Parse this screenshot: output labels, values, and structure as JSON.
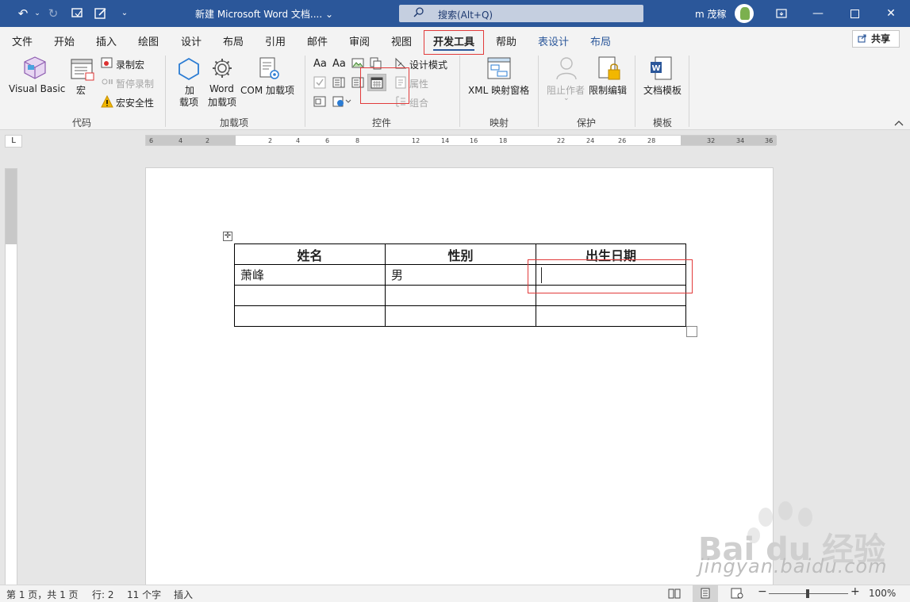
{
  "titlebar": {
    "doc_title": "新建 Microsoft Word 文档.... ⌄",
    "search_placeholder": "搜索(Alt+Q)",
    "user_name": "m 茂稼"
  },
  "menu": {
    "tabs": [
      "文件",
      "开始",
      "插入",
      "绘图",
      "设计",
      "布局",
      "引用",
      "邮件",
      "审阅",
      "视图",
      "开发工具",
      "帮助",
      "表设计",
      "布局"
    ],
    "active_tab": "开发工具",
    "share_label": "共享"
  },
  "ribbon": {
    "code": {
      "visual_basic": "Visual Basic",
      "macro": "宏",
      "record_macro": "录制宏",
      "pause_record": "暂停录制",
      "macro_security": "宏安全性",
      "label": "代码"
    },
    "addins": {
      "addin": "加",
      "addin2": "载项",
      "word_addin": "Word",
      "word_addin2": "加载项",
      "com_addin": "COM 加载项",
      "label": "加载项"
    },
    "controls": {
      "design_mode": "设计模式",
      "properties": "属性",
      "group": "组合",
      "label": "控件",
      "aa1": "Aa",
      "aa2": "Aa"
    },
    "mapping": {
      "xml_pane": "XML 映射窗格",
      "label": "映射"
    },
    "protect": {
      "block_authors": "阻止作者",
      "restrict_editing": "限制编辑",
      "label": "保护"
    },
    "templates": {
      "doc_template": "文档模板",
      "label": "模板"
    }
  },
  "ruler": {
    "ticks": [
      "6",
      "4",
      "2",
      "2",
      "4",
      "6",
      "8",
      "12",
      "14",
      "16",
      "18",
      "22",
      "24",
      "26",
      "28",
      "32",
      "34",
      "36"
    ]
  },
  "table": {
    "headers": [
      "姓名",
      "性别",
      "出生日期"
    ],
    "rows": [
      [
        "萧峰",
        "男",
        ""
      ],
      [
        "",
        "",
        ""
      ],
      [
        "",
        "",
        ""
      ]
    ]
  },
  "watermark": {
    "brand": "Bai du 经验",
    "url": "jingyan.baidu.com"
  },
  "status": {
    "page": "第 1 页，共 1 页",
    "line": "行: 2",
    "words": "11 个字",
    "mode": "插入",
    "zoom": "100%",
    "zoom_value": 100
  },
  "colors": {
    "accent": "#2b579a",
    "highlight": "#e23b3b"
  }
}
